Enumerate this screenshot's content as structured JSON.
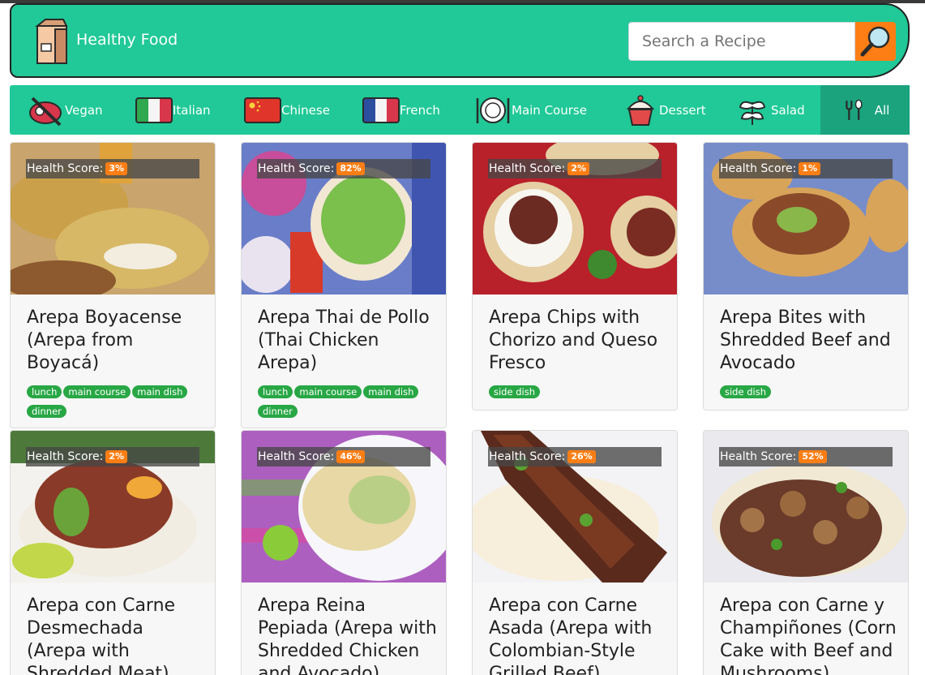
{
  "header": {
    "brand": "Healthy Food",
    "search_placeholder": "Search a Recipe"
  },
  "categories": [
    {
      "label": "Vegan",
      "icon": "no-meat-icon"
    },
    {
      "label": "Italian",
      "icon": "italy-flag-icon"
    },
    {
      "label": "Chinese",
      "icon": "china-flag-icon"
    },
    {
      "label": "French",
      "icon": "france-flag-icon"
    },
    {
      "label": "Main Course",
      "icon": "plate-icon"
    },
    {
      "label": "Dessert",
      "icon": "cupcake-icon"
    },
    {
      "label": "Salad",
      "icon": "herb-icon"
    },
    {
      "label": "All",
      "icon": "cutlery-icon",
      "active": true
    }
  ],
  "health_label": "Health Score:",
  "colors": {
    "brand": "#20c997",
    "accent": "#fd7e14",
    "tag": "#28a745"
  },
  "recipes": [
    {
      "title": "Arepa Boyacense (Arepa from Boyacá)",
      "score": "3%",
      "tags": [
        "lunch",
        "main course",
        "main dish",
        "dinner"
      ]
    },
    {
      "title": "Arepa Thai de Pollo (Thai Chicken Arepa)",
      "score": "82%",
      "tags": [
        "lunch",
        "main course",
        "main dish",
        "dinner"
      ]
    },
    {
      "title": "Arepa Chips with Chorizo and Queso Fresco",
      "score": "2%",
      "tags": [
        "side dish"
      ]
    },
    {
      "title": "Arepa Bites with Shredded Beef and Avocado",
      "score": "1%",
      "tags": [
        "side dish"
      ]
    },
    {
      "title": "Arepa con Carne Desmechada (Arepa with Shredded Meat)",
      "score": "2%",
      "tags": []
    },
    {
      "title": "Arepa Reina Pepiada (Arepa with Shredded Chicken and Avocado)",
      "score": "46%",
      "tags": []
    },
    {
      "title": "Arepa con Carne Asada (Arepa with Colombian-Style Grilled Beef)",
      "score": "26%",
      "tags": []
    },
    {
      "title": "Arepa con Carne y Champiñones (Corn Cake with Beef and Mushrooms)",
      "score": "52%",
      "tags": []
    }
  ]
}
